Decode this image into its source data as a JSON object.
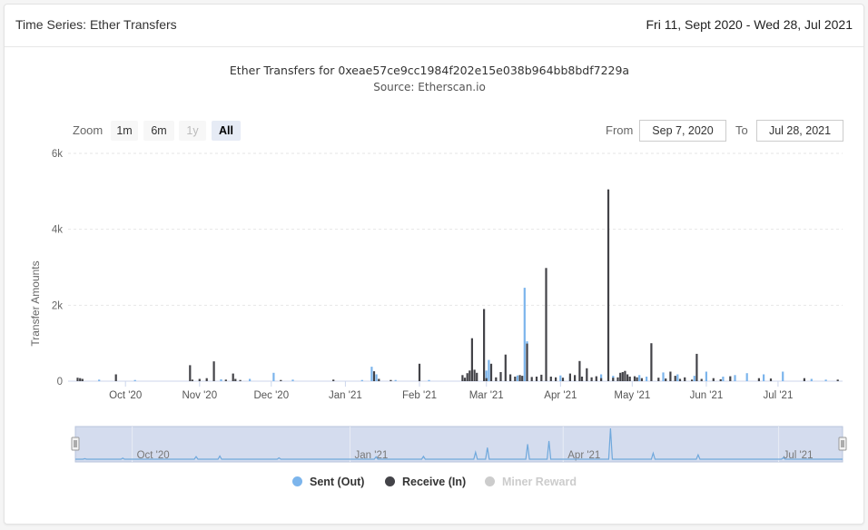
{
  "header": {
    "title": "Time Series: Ether Transfers",
    "date_range": "Fri 11, Sept 2020 - Wed 28, Jul 2021"
  },
  "chart_title": "Ether Transfers for 0xeae57ce9cc1984f202e15e038b964bb8bdf7229a",
  "chart_subtitle": "Source: Etherscan.io",
  "range_selector": {
    "zoom_label": "Zoom",
    "buttons": [
      "1m",
      "6m",
      "1y",
      "All"
    ],
    "selected": "All",
    "disabled": [
      "1y"
    ],
    "from_label": "From",
    "from_value": "Sep 7, 2020",
    "to_label": "To",
    "to_value": "Jul 28, 2021"
  },
  "legend": {
    "sent": "Sent (Out)",
    "receive": "Receive (In)",
    "miner": "Miner Reward"
  },
  "colors": {
    "sent": "#7cb5ec",
    "receive": "#434348",
    "miner": "#cccccc",
    "navigator_fill": "#ccd6eb",
    "navigator_line": "#6fa8dc"
  },
  "chart_data": {
    "type": "bar",
    "title": "Ether Transfers for 0xeae57ce9cc1984f202e15e038b964bb8bdf7229a",
    "subtitle": "Source: Etherscan.io",
    "ylabel": "Transfer Amounts",
    "xlabel": "",
    "x_range": [
      "2020-09-07",
      "2021-07-28"
    ],
    "ylim": [
      0,
      6000
    ],
    "y_ticks": [
      0,
      2000,
      4000,
      6000
    ],
    "y_tick_labels": [
      "0",
      "2k",
      "4k",
      "6k"
    ],
    "x_ticks": [
      "2020-10-01",
      "2020-11-01",
      "2020-12-01",
      "2021-01-01",
      "2021-02-01",
      "2021-03-01",
      "2021-04-01",
      "2021-05-01",
      "2021-06-01",
      "2021-07-01"
    ],
    "x_tick_labels": [
      "Oct '20",
      "Nov '20",
      "Dec '20",
      "Jan '21",
      "Feb '21",
      "Mar '21",
      "Apr '21",
      "May '21",
      "Jun '21",
      "Jul '21"
    ],
    "navigator_ticks": [
      "2020-10-01",
      "2021-01-01",
      "2021-04-01",
      "2021-07-01"
    ],
    "navigator_tick_labels": [
      "Oct '20",
      "Jan '21",
      "Apr '21",
      "Jul '21"
    ],
    "grid": true,
    "legend_position": "bottom-center",
    "series": [
      {
        "name": "Sent (Out)",
        "key": "sent",
        "points": [
          [
            "2020-09-20",
            40
          ],
          [
            "2020-10-05",
            30
          ],
          [
            "2020-11-10",
            50
          ],
          [
            "2020-11-22",
            60
          ],
          [
            "2020-12-02",
            220
          ],
          [
            "2020-12-10",
            40
          ],
          [
            "2021-01-08",
            30
          ],
          [
            "2021-01-12",
            380
          ],
          [
            "2021-01-14",
            180
          ],
          [
            "2021-01-22",
            30
          ],
          [
            "2021-02-05",
            30
          ],
          [
            "2021-03-01",
            280
          ],
          [
            "2021-03-02",
            560
          ],
          [
            "2021-03-14",
            150
          ],
          [
            "2021-03-17",
            2460
          ],
          [
            "2021-03-18",
            1050
          ],
          [
            "2021-04-01",
            150
          ],
          [
            "2021-04-05",
            120
          ],
          [
            "2021-04-18",
            180
          ],
          [
            "2021-04-23",
            140
          ],
          [
            "2021-05-04",
            160
          ],
          [
            "2021-05-07",
            120
          ],
          [
            "2021-05-14",
            230
          ],
          [
            "2021-05-20",
            180
          ],
          [
            "2021-05-27",
            140
          ],
          [
            "2021-06-01",
            250
          ],
          [
            "2021-06-08",
            120
          ],
          [
            "2021-06-13",
            160
          ],
          [
            "2021-06-18",
            210
          ],
          [
            "2021-06-25",
            180
          ],
          [
            "2021-07-03",
            250
          ],
          [
            "2021-07-15",
            60
          ],
          [
            "2021-07-21",
            40
          ]
        ]
      },
      {
        "name": "Receive (In)",
        "key": "receive",
        "points": [
          [
            "2020-09-11",
            90
          ],
          [
            "2020-09-12",
            80
          ],
          [
            "2020-09-13",
            60
          ],
          [
            "2020-09-27",
            180
          ],
          [
            "2020-10-28",
            420
          ],
          [
            "2020-10-29",
            40
          ],
          [
            "2020-11-01",
            60
          ],
          [
            "2020-11-04",
            80
          ],
          [
            "2020-11-07",
            520
          ],
          [
            "2020-11-12",
            40
          ],
          [
            "2020-11-15",
            200
          ],
          [
            "2020-11-16",
            60
          ],
          [
            "2020-11-18",
            30
          ],
          [
            "2020-12-05",
            30
          ],
          [
            "2020-12-27",
            40
          ],
          [
            "2021-01-13",
            260
          ],
          [
            "2021-01-15",
            60
          ],
          [
            "2021-01-20",
            30
          ],
          [
            "2021-02-01",
            460
          ],
          [
            "2021-02-19",
            160
          ],
          [
            "2021-02-20",
            90
          ],
          [
            "2021-02-21",
            210
          ],
          [
            "2021-02-22",
            280
          ],
          [
            "2021-02-23",
            1130
          ],
          [
            "2021-02-24",
            300
          ],
          [
            "2021-02-25",
            220
          ],
          [
            "2021-02-28",
            1900
          ],
          [
            "2021-03-01",
            80
          ],
          [
            "2021-03-03",
            460
          ],
          [
            "2021-03-05",
            100
          ],
          [
            "2021-03-07",
            240
          ],
          [
            "2021-03-09",
            700
          ],
          [
            "2021-03-11",
            180
          ],
          [
            "2021-03-13",
            120
          ],
          [
            "2021-03-15",
            160
          ],
          [
            "2021-03-16",
            140
          ],
          [
            "2021-03-18",
            990
          ],
          [
            "2021-03-20",
            110
          ],
          [
            "2021-03-22",
            120
          ],
          [
            "2021-03-24",
            170
          ],
          [
            "2021-03-26",
            2980
          ],
          [
            "2021-03-28",
            120
          ],
          [
            "2021-03-30",
            100
          ],
          [
            "2021-04-02",
            90
          ],
          [
            "2021-04-05",
            200
          ],
          [
            "2021-04-07",
            160
          ],
          [
            "2021-04-09",
            530
          ],
          [
            "2021-04-10",
            120
          ],
          [
            "2021-04-12",
            340
          ],
          [
            "2021-04-14",
            100
          ],
          [
            "2021-04-16",
            130
          ],
          [
            "2021-04-18",
            80
          ],
          [
            "2021-04-21",
            5050
          ],
          [
            "2021-04-23",
            90
          ],
          [
            "2021-04-25",
            100
          ],
          [
            "2021-04-26",
            220
          ],
          [
            "2021-04-27",
            240
          ],
          [
            "2021-04-28",
            270
          ],
          [
            "2021-04-29",
            180
          ],
          [
            "2021-04-30",
            120
          ],
          [
            "2021-05-02",
            130
          ],
          [
            "2021-05-03",
            100
          ],
          [
            "2021-05-05",
            80
          ],
          [
            "2021-05-09",
            1000
          ],
          [
            "2021-05-12",
            90
          ],
          [
            "2021-05-15",
            70
          ],
          [
            "2021-05-17",
            250
          ],
          [
            "2021-05-19",
            140
          ],
          [
            "2021-05-21",
            60
          ],
          [
            "2021-05-23",
            100
          ],
          [
            "2021-05-26",
            40
          ],
          [
            "2021-05-28",
            720
          ],
          [
            "2021-05-30",
            60
          ],
          [
            "2021-06-04",
            80
          ],
          [
            "2021-06-07",
            50
          ],
          [
            "2021-06-11",
            130
          ],
          [
            "2021-06-23",
            80
          ],
          [
            "2021-06-28",
            70
          ],
          [
            "2021-07-12",
            80
          ],
          [
            "2021-07-26",
            40
          ]
        ]
      },
      {
        "name": "Miner Reward",
        "key": "miner",
        "points": []
      }
    ],
    "navigator_peaks": [
      [
        "2020-09-11",
        90
      ],
      [
        "2020-09-27",
        180
      ],
      [
        "2020-10-28",
        420
      ],
      [
        "2020-11-07",
        520
      ],
      [
        "2020-12-02",
        220
      ],
      [
        "2021-01-12",
        380
      ],
      [
        "2021-02-01",
        460
      ],
      [
        "2021-02-23",
        1130
      ],
      [
        "2021-02-28",
        1900
      ],
      [
        "2021-03-17",
        2460
      ],
      [
        "2021-03-26",
        2980
      ],
      [
        "2021-04-21",
        5050
      ],
      [
        "2021-05-09",
        1000
      ],
      [
        "2021-05-28",
        720
      ],
      [
        "2021-07-03",
        250
      ]
    ]
  }
}
